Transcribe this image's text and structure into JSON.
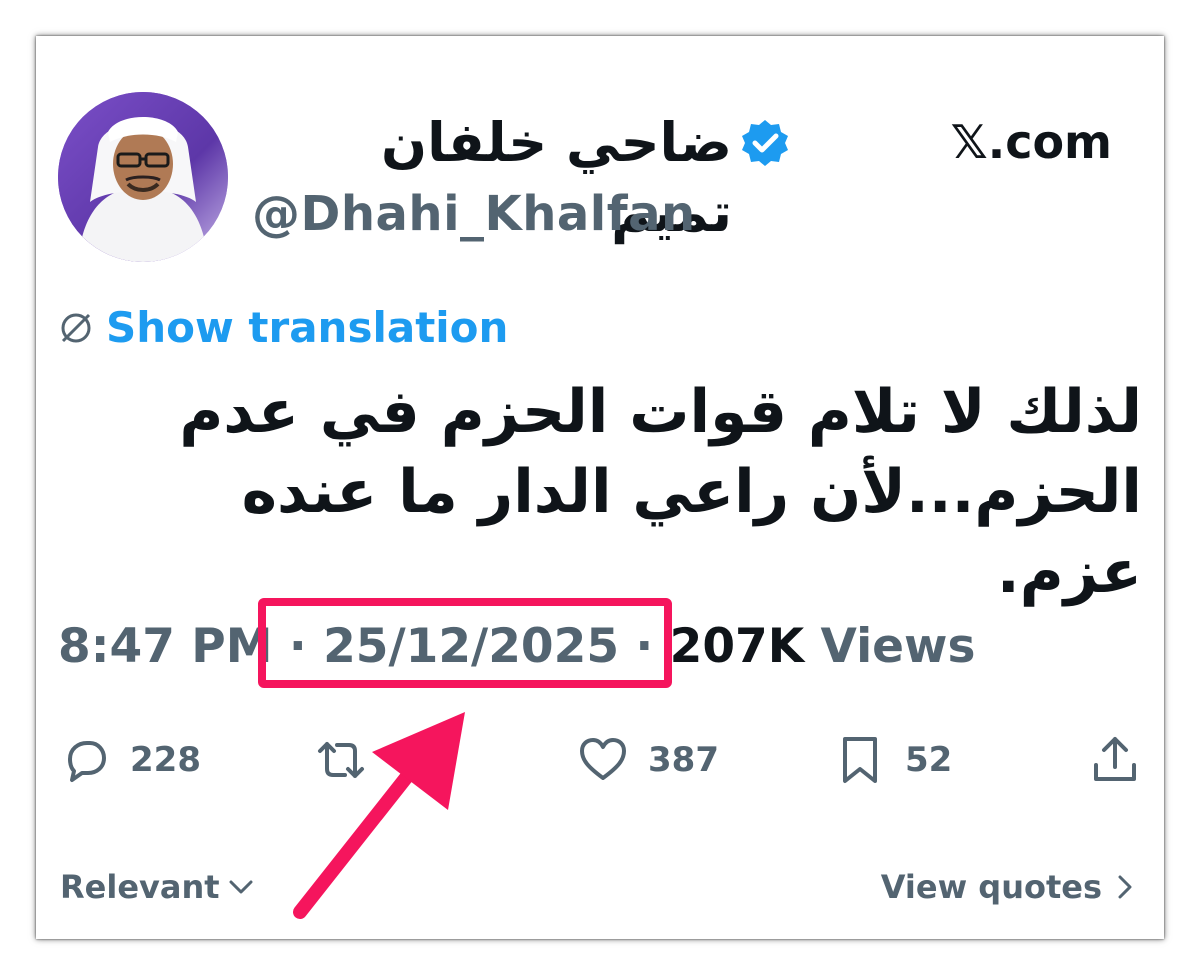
{
  "author": {
    "display_name": "ضاحي خلفان تميم",
    "handle": "@Dhahi_Khalfan",
    "verified_icon": "verified-badge-icon"
  },
  "site_label": "𝕏.com",
  "translation_label": "Show translation",
  "tweet": {
    "line1": "لذلك لا تلام قوات الحزم في عدم",
    "line2": "الحزم...لأن راعي الدار ما  عنده عزم."
  },
  "meta": {
    "time": "8:47 PM",
    "separator": " · ",
    "date": "25/12/2025",
    "views_count": "207K",
    "views_label": " Views"
  },
  "actions": {
    "replies": "228",
    "reposts": "",
    "likes": "387",
    "bookmarks": "52"
  },
  "footer": {
    "sort_label": "Relevant",
    "quotes_label": "View quotes"
  },
  "colors": {
    "accent": "#1d9bf0",
    "highlight": "#f5155d",
    "muted": "#536471",
    "text": "#0f1419"
  }
}
